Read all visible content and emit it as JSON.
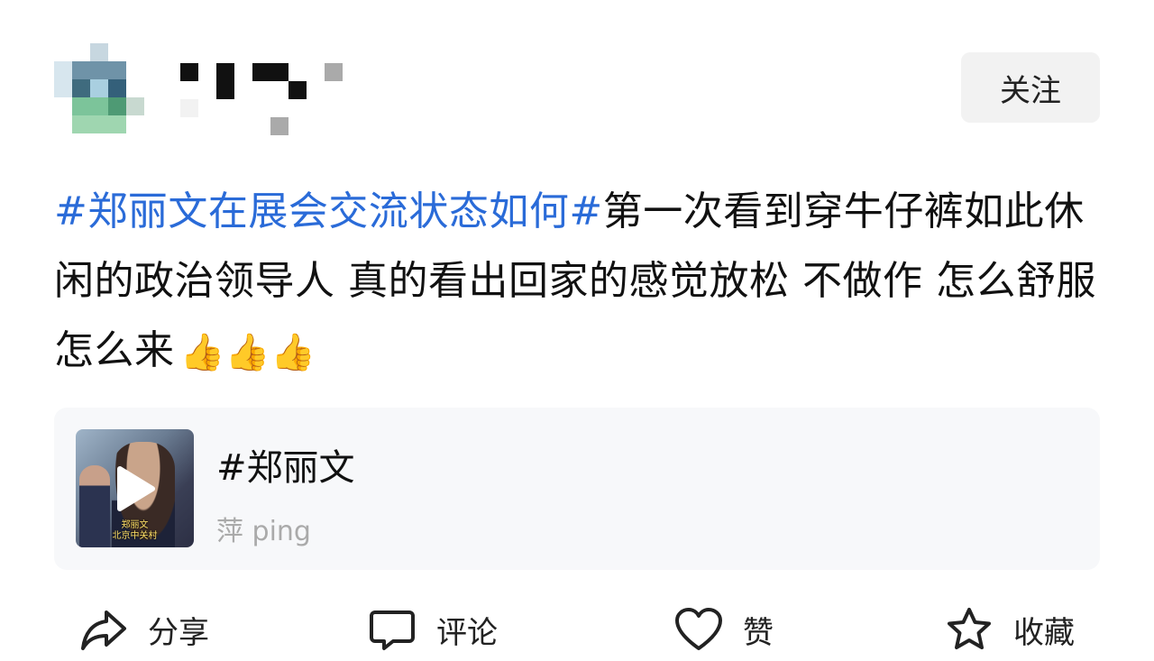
{
  "header": {
    "follow_label": "关注"
  },
  "post": {
    "hashtag": "#郑丽文在展会交流状态如何#",
    "text": "第一次看到穿牛仔裤如此休闲的政治领导人  真的看出回家的感觉放松  不做作 怎么舒服怎么来",
    "emoji": "👍👍👍"
  },
  "video_card": {
    "title": "#郑丽文",
    "author": "萍 ping",
    "thumbnail_caption": "郑丽文\n北京中关村"
  },
  "actions": {
    "share": "分享",
    "comment": "评论",
    "like": "赞",
    "favorite": "收藏"
  },
  "colors": {
    "hashtag": "#2a6bd8",
    "follow_bg": "#f2f2f2",
    "card_bg": "#f7f8fa",
    "muted": "#aaaaaa"
  }
}
